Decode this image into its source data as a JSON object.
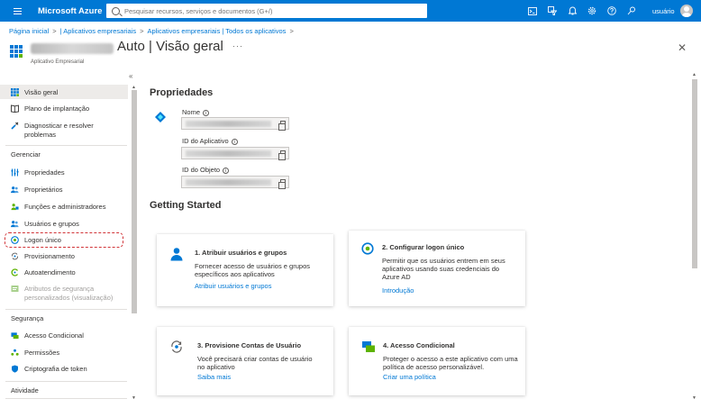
{
  "topbar": {
    "brand": "Microsoft Azure",
    "search_placeholder": "Pesquisar recursos, serviços e documentos (G+/)",
    "user": "usuário"
  },
  "breadcrumb": [
    "Página inicial",
    "| Aplicativos empresariais",
    "Aplicativos empresariais | Todos os aplicativos"
  ],
  "header": {
    "title": "Auto | Visão geral",
    "subtitle": "Aplicativo Empresarial",
    "more": "···",
    "close": "✕"
  },
  "sidebar": {
    "collapse": "«",
    "top_items": [
      {
        "label": "Visão geral",
        "icon": "overview-grid-icon"
      },
      {
        "label": "Plano de implantação",
        "icon": "book-icon"
      },
      {
        "label": "Diagnosticar e resolver problemas",
        "icon": "wrench-icon"
      }
    ],
    "sections": [
      {
        "heading": "Gerenciar",
        "items": [
          {
            "label": "Propriedades",
            "icon": "properties-icon"
          },
          {
            "label": "Proprietários",
            "icon": "owners-icon"
          },
          {
            "label": "Funções e administradores",
            "icon": "roles-icon"
          },
          {
            "label": "Usuários e grupos",
            "icon": "users-groups-icon"
          },
          {
            "label": "Logon único",
            "icon": "sso-icon"
          },
          {
            "label": "Provisionamento",
            "icon": "provisioning-icon"
          },
          {
            "label": "Autoatendimento",
            "icon": "self-service-icon"
          },
          {
            "label": "Atributos de segurança personalizados (visualização)",
            "icon": "security-attributes-icon"
          }
        ]
      },
      {
        "heading": "Segurança",
        "items": [
          {
            "label": "Acesso Condicional",
            "icon": "conditional-access-icon"
          },
          {
            "label": "Permissões",
            "icon": "permissions-icon"
          },
          {
            "label": "Criptografia de token",
            "icon": "shield-icon"
          }
        ]
      },
      {
        "heading": "Atividade",
        "items": []
      }
    ]
  },
  "properties": {
    "title": "Propriedades",
    "fields": [
      {
        "label": "Nome"
      },
      {
        "label": "ID do Aplicativo"
      },
      {
        "label": "ID do Objeto"
      }
    ]
  },
  "getting_started": {
    "title": "Getting Started",
    "cards": [
      {
        "title": "1. Atribuir usuários e grupos",
        "desc": "Fornecer acesso de usuários e grupos específicos aos aplicativos",
        "link": "Atribuir usuários e grupos",
        "icon": "user-icon"
      },
      {
        "title": "2. Configurar logon único",
        "desc": "Permitir que os usuários entrem em seus aplicativos usando suas credenciais do Azure AD",
        "link": "Introdução",
        "icon": "sso-icon"
      },
      {
        "title": "3. Provisione Contas de Usuário",
        "desc": "Você precisará criar contas de usuário no aplicativo",
        "link": "Saiba mais",
        "icon": "provisioning-icon"
      },
      {
        "title": "4. Acesso Condicional",
        "desc": "Proteger o acesso a este aplicativo com uma política de acesso personalizável.",
        "link": "Criar uma política",
        "icon": "conditional-access-icon"
      }
    ]
  },
  "colors": {
    "accent": "#0078d4",
    "highlight": "#d13438"
  }
}
